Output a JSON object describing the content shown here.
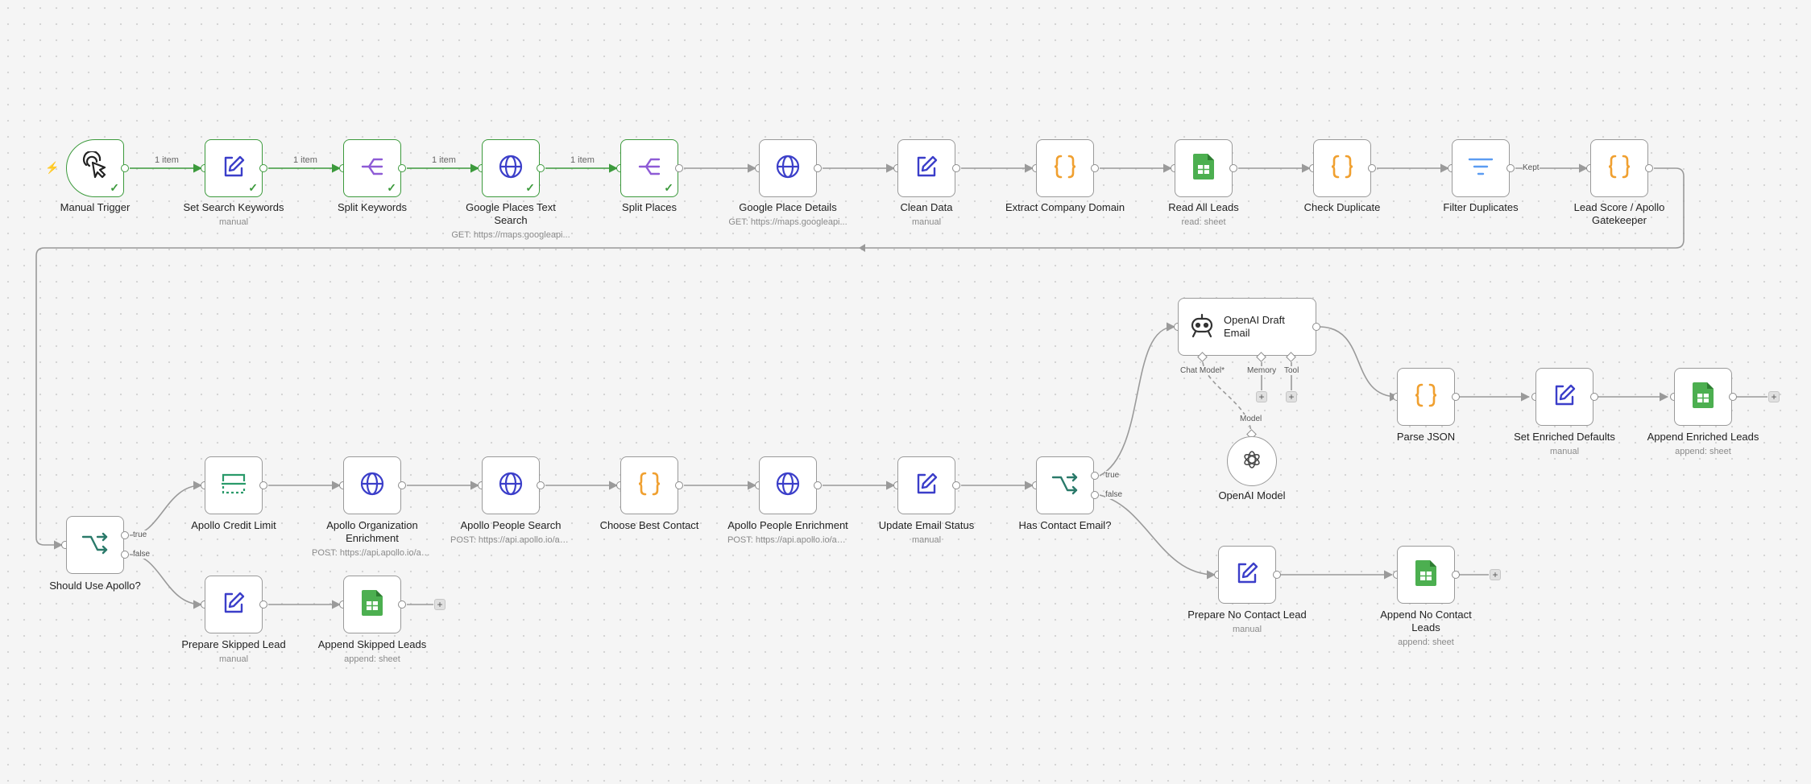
{
  "item_count_label": "1 item",
  "nodes": {
    "manual_trigger": {
      "title": "Manual Trigger"
    },
    "set_search_keywords": {
      "title": "Set Search Keywords",
      "subtitle": "manual"
    },
    "split_keywords": {
      "title": "Split Keywords"
    },
    "google_places_text_search": {
      "title": "Google Places Text Search",
      "subtitle": "GET: https://maps.googleapi..."
    },
    "split_places": {
      "title": "Split Places"
    },
    "google_place_details": {
      "title": "Google Place Details",
      "subtitle": "GET: https://maps.googleapi..."
    },
    "clean_data": {
      "title": "Clean Data",
      "subtitle": "manual"
    },
    "extract_company_domain": {
      "title": "Extract Company Domain"
    },
    "read_all_leads": {
      "title": "Read All Leads",
      "subtitle": "read: sheet"
    },
    "check_duplicate": {
      "title": "Check Duplicate"
    },
    "filter_duplicates": {
      "title": "Filter Duplicates"
    },
    "lead_score": {
      "title": "Lead Score / Apollo Gatekeeper"
    },
    "should_use_apollo": {
      "title": "Should Use Apollo?"
    },
    "apollo_credit_limit": {
      "title": "Apollo Credit Limit"
    },
    "apollo_org_enrichment": {
      "title": "Apollo Organization Enrichment",
      "subtitle": "POST: https://api.apollo.io/ap..."
    },
    "apollo_people_search": {
      "title": "Apollo People Search",
      "subtitle": "POST: https://api.apollo.io/ap..."
    },
    "choose_best_contact": {
      "title": "Choose Best Contact"
    },
    "apollo_people_enrichment": {
      "title": "Apollo People Enrichment",
      "subtitle": "POST: https://api.apollo.io/ap..."
    },
    "update_email_status": {
      "title": "Update Email Status",
      "subtitle": "manual"
    },
    "has_contact_email": {
      "title": "Has Contact Email?"
    },
    "openai_draft_email": {
      "title": "OpenAI Draft Email"
    },
    "openai_model": {
      "title": "OpenAI Model"
    },
    "parse_json": {
      "title": "Parse JSON"
    },
    "set_enriched_defaults": {
      "title": "Set Enriched Defaults",
      "subtitle": "manual"
    },
    "append_enriched_leads": {
      "title": "Append Enriched Leads",
      "subtitle": "append: sheet"
    },
    "prepare_skipped_lead": {
      "title": "Prepare Skipped Lead",
      "subtitle": "manual"
    },
    "append_skipped_leads": {
      "title": "Append Skipped Leads",
      "subtitle": "append: sheet"
    },
    "prepare_no_contact_lead": {
      "title": "Prepare No Contact Lead",
      "subtitle": "manual"
    },
    "append_no_contact_leads": {
      "title": "Append No Contact Leads",
      "subtitle": "append: sheet"
    }
  },
  "branch_labels": {
    "true": "true",
    "false": "false",
    "kept": "Kept"
  },
  "agent_ports": {
    "chat_model": "Chat Model*",
    "memory": "Memory",
    "tool": "Tool",
    "model": "Model"
  },
  "plus_symbol": "+",
  "check_symbol": "✓",
  "colors": {
    "success": "#3c9a3c",
    "edge": "#9a9a9a",
    "code": "#f0a030",
    "http": "#3b3ec9",
    "sheets": "#4caf50",
    "filter": "#5b9cf2",
    "if": "#2a7a6a",
    "split": "#8e5bd6",
    "trigger_bolt": "#ff6d2a"
  }
}
